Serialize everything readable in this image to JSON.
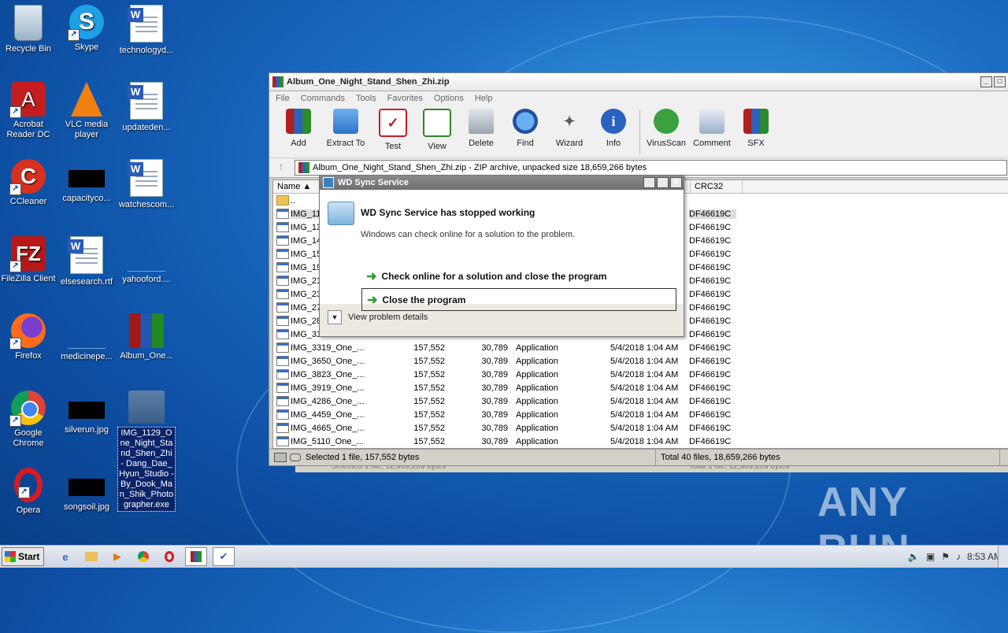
{
  "desktop": {
    "icons": [
      {
        "label": "Recycle Bin"
      },
      {
        "label": "Skype"
      },
      {
        "label": "technologyd..."
      },
      {
        "label": "Acrobat Reader DC"
      },
      {
        "label": "VLC media player"
      },
      {
        "label": "updateden..."
      },
      {
        "label": "CCleaner"
      },
      {
        "label": "capacityco..."
      },
      {
        "label": "watchescom..."
      },
      {
        "label": "FileZilla Client"
      },
      {
        "label": "elsesearch.rtf"
      },
      {
        "label": "yahooford...."
      },
      {
        "label": "Firefox"
      },
      {
        "label": "medicinepe..."
      },
      {
        "label": "Album_One..."
      },
      {
        "label": "Google Chrome"
      },
      {
        "label": "silverun.jpg"
      },
      {
        "label": "IMG_1129_One_Night_Stand_Shen_Zhi - Dang_Dae_Hyun_Studio - By_Dook_Man_Shik_Photographer.exe"
      },
      {
        "label": "Opera"
      },
      {
        "label": "songsoil.jpg"
      }
    ]
  },
  "winrar": {
    "title": "Album_One_Night_Stand_Shen_Zhi.zip",
    "menu": [
      "File",
      "Commands",
      "Tools",
      "Favorites",
      "Options",
      "Help"
    ],
    "toolbar": [
      "Add",
      "Extract To",
      "Test",
      "View",
      "Delete",
      "Find",
      "Wizard",
      "Info",
      "VirusScan",
      "Comment",
      "SFX"
    ],
    "address": "Album_One_Night_Stand_Shen_Zhi.zip - ZIP archive, unpacked size 18,659,266 bytes",
    "columns": {
      "name": "Name",
      "crc": "CRC32"
    },
    "parent": "..",
    "rows": [
      {
        "name": "IMG_11",
        "crc": "DF46619C"
      },
      {
        "name": "IMG_13",
        "crc": "DF46619C"
      },
      {
        "name": "IMG_14",
        "crc": "DF46619C"
      },
      {
        "name": "IMG_15",
        "crc": "DF46619C"
      },
      {
        "name": "IMG_19",
        "crc": "DF46619C"
      },
      {
        "name": "IMG_21",
        "crc": "DF46619C"
      },
      {
        "name": "IMG_23",
        "crc": "DF46619C"
      },
      {
        "name": "IMG_27",
        "crc": "DF46619C"
      },
      {
        "name": "IMG_28",
        "crc": "DF46619C"
      },
      {
        "name": "IMG_31",
        "crc": "DF46619C"
      },
      {
        "name": "IMG_3319_One_...",
        "size": "157,552",
        "packed": "30,789",
        "type": "Application",
        "modified": "5/4/2018 1:04 AM",
        "crc": "DF46619C"
      },
      {
        "name": "IMG_3650_One_...",
        "size": "157,552",
        "packed": "30,789",
        "type": "Application",
        "modified": "5/4/2018 1:04 AM",
        "crc": "DF46619C"
      },
      {
        "name": "IMG_3823_One_...",
        "size": "157,552",
        "packed": "30,789",
        "type": "Application",
        "modified": "5/4/2018 1:04 AM",
        "crc": "DF46619C"
      },
      {
        "name": "IMG_3919_One_...",
        "size": "157,552",
        "packed": "30,789",
        "type": "Application",
        "modified": "5/4/2018 1:04 AM",
        "crc": "DF46619C"
      },
      {
        "name": "IMG_4286_One_...",
        "size": "157,552",
        "packed": "30,789",
        "type": "Application",
        "modified": "5/4/2018 1:04 AM",
        "crc": "DF46619C"
      },
      {
        "name": "IMG_4459_One_...",
        "size": "157,552",
        "packed": "30,789",
        "type": "Application",
        "modified": "5/4/2018 1:04 AM",
        "crc": "DF46619C"
      },
      {
        "name": "IMG_4665_One_...",
        "size": "157,552",
        "packed": "30,789",
        "type": "Application",
        "modified": "5/4/2018 1:04 AM",
        "crc": "DF46619C"
      },
      {
        "name": "IMG_5110_One_...",
        "size": "157,552",
        "packed": "30,789",
        "type": "Application",
        "modified": "5/4/2018 1:04 AM",
        "crc": "DF46619C"
      }
    ],
    "status_left": "Selected 1 file, 157,552 bytes",
    "status_right": "Total 40 files, 18,659,266 bytes"
  },
  "ghost_status": {
    "left": "Selected 1 file, 12,909,209 bytes",
    "right": "Total 1 file, 12,909,209 bytes"
  },
  "dialog": {
    "title": "WD Sync Service",
    "heading": "WD Sync Service has stopped working",
    "message": "Windows can check online for a solution to the problem.",
    "option1": "Check online for a solution and close the program",
    "option2": "Close the program",
    "details": "View problem details"
  },
  "watermark": "ANY RUN",
  "taskbar": {
    "start": "Start",
    "clock": "8:53 AM"
  }
}
